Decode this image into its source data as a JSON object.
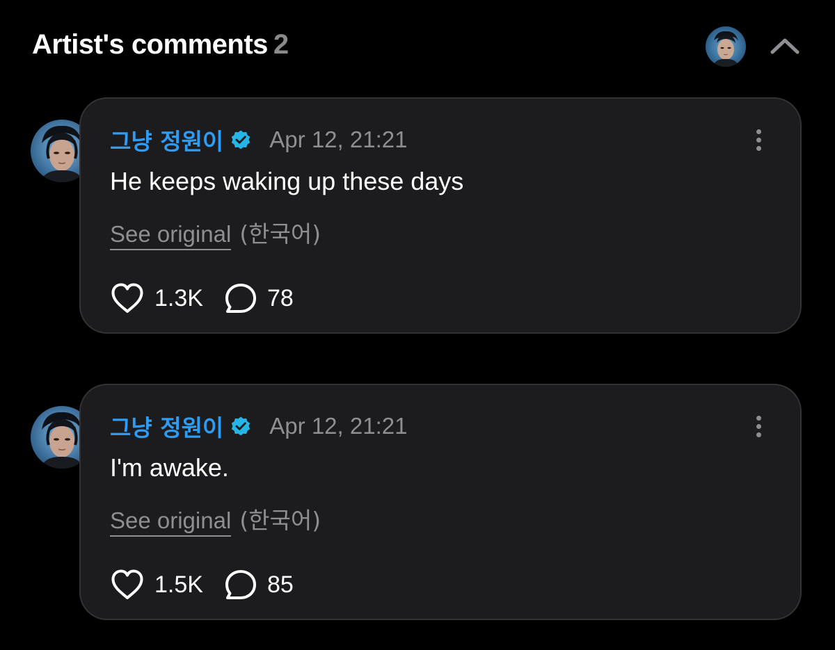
{
  "header": {
    "title": "Artist's comments",
    "count": "2",
    "avatar_icon": "artist-avatar",
    "collapse_icon": "chevron-up-icon"
  },
  "colors": {
    "background": "#000000",
    "card": "#1c1c1e",
    "card_border": "#333336",
    "author_blue": "#2f9cf4",
    "verified_teal": "#25b5e6",
    "muted_text": "#8e8e93"
  },
  "comments": [
    {
      "author": "그냥 정원이",
      "verified": true,
      "timestamp": "Apr 12, 21:21",
      "text": "He keeps waking up these days",
      "see_original_label": "See original",
      "language": "(한국어)",
      "likes": "1.3K",
      "replies": "78"
    },
    {
      "author": "그냥 정원이",
      "verified": true,
      "timestamp": "Apr 12, 21:21",
      "text": "I'm awake.",
      "see_original_label": "See original",
      "language": "(한국어)",
      "likes": "1.5K",
      "replies": "85"
    }
  ]
}
